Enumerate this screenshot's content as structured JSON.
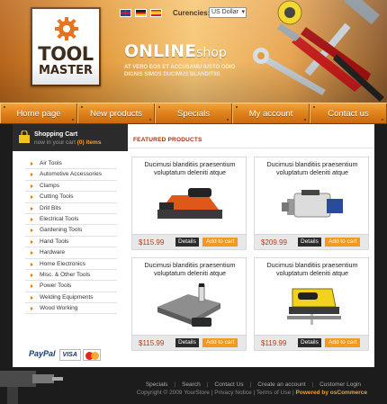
{
  "header": {
    "logo_line1": "TOOL",
    "logo_line2": "MASTER",
    "currencies_label": "Curencies:",
    "currency_selected": "US Dollar",
    "online": "ONLINE",
    "shop": "shop",
    "tagline": "AT VERO EOS ET ACCUSAMU IUSTO ODIO DIGNIS SIMOS DUCIMUS BLANDITIIS"
  },
  "nav": [
    {
      "label": "Home page"
    },
    {
      "label": "New products"
    },
    {
      "label": "Specials"
    },
    {
      "label": "My account"
    },
    {
      "label": "Contact us"
    }
  ],
  "cart": {
    "title": "Shopping Cart",
    "subtitle": "now in your cart",
    "count": "(0) items"
  },
  "categories": [
    "Air Tools",
    "Automotive Accessories",
    "Clamps",
    "Cutting Tools",
    "Drill Bits",
    "Electrical Tools",
    "Gardening Tools",
    "Hand Tools",
    "Hardware",
    "Home Electronics",
    "Misc. & Other Tools",
    "Power Tools",
    "Welding Equipments",
    "Wood Working"
  ],
  "payments": {
    "paypal": "PayPal",
    "visa": "VISA"
  },
  "featured_title": "FEATURED PRODUCTS",
  "products": [
    {
      "title": "Ducimusi blanditiis praesentium voluptatum deleniti atque",
      "price": "$115.99",
      "details": "Details",
      "add": "Add to cart"
    },
    {
      "title": "Ducimusi blanditiis praesentium voluptatum deleniti atque",
      "price": "$209.99",
      "details": "Details",
      "add": "Add to cart"
    },
    {
      "title": "Ducimusi blanditiis praesentium voluptatum deleniti atque",
      "price": "$115.99",
      "details": "Details",
      "add": "Add to cart"
    },
    {
      "title": "Ducimusi blanditiis praesentium voluptatum deleniti atque",
      "price": "$119.99",
      "details": "Details",
      "add": "Add to cart"
    }
  ],
  "footer": {
    "links": [
      "Specials",
      "Search",
      "Contact Us",
      "Create an account",
      "Customer Login"
    ],
    "copyright": "Copyright © 2009 YourStore | Privacy Notice | Terms of Use |",
    "powered": "Powered by osCommerce"
  },
  "colors": {
    "accent": "#f29a1e",
    "nav": "#e0811a",
    "price": "#b33c16"
  }
}
